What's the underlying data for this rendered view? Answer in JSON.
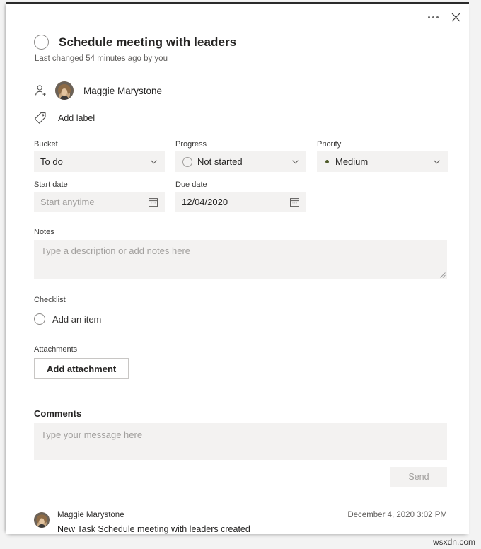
{
  "window": {
    "more_options_label": "More options",
    "close_label": "Close"
  },
  "task": {
    "title": "Schedule meeting with leaders",
    "last_changed": "Last changed 54 minutes ago by you",
    "complete_checkbox_label": "Mark task complete"
  },
  "assignee": {
    "name": "Maggie Marystone",
    "add_icon_label": "Assign"
  },
  "label": {
    "text": "Add label"
  },
  "fields": {
    "bucket": {
      "label": "Bucket",
      "value": "To do"
    },
    "progress": {
      "label": "Progress",
      "value": "Not started"
    },
    "priority": {
      "label": "Priority",
      "value": "Medium",
      "dot_color": "#4f5b2a"
    },
    "start_date": {
      "label": "Start date",
      "value": "",
      "placeholder": "Start anytime"
    },
    "due_date": {
      "label": "Due date",
      "value": "12/04/2020"
    }
  },
  "notes": {
    "label": "Notes",
    "value": "",
    "placeholder": "Type a description or add notes here"
  },
  "checklist": {
    "label": "Checklist",
    "add_item_text": "Add an item"
  },
  "attachments": {
    "label": "Attachments",
    "add_button": "Add attachment"
  },
  "comments": {
    "heading": "Comments",
    "value": "",
    "placeholder": "Type your message here",
    "send_label": "Send"
  },
  "activity": [
    {
      "author": "Maggie Marystone",
      "timestamp": "December 4, 2020 3:02 PM",
      "text": "New Task Schedule meeting with leaders created"
    }
  ],
  "watermark": "wsxdn.com"
}
